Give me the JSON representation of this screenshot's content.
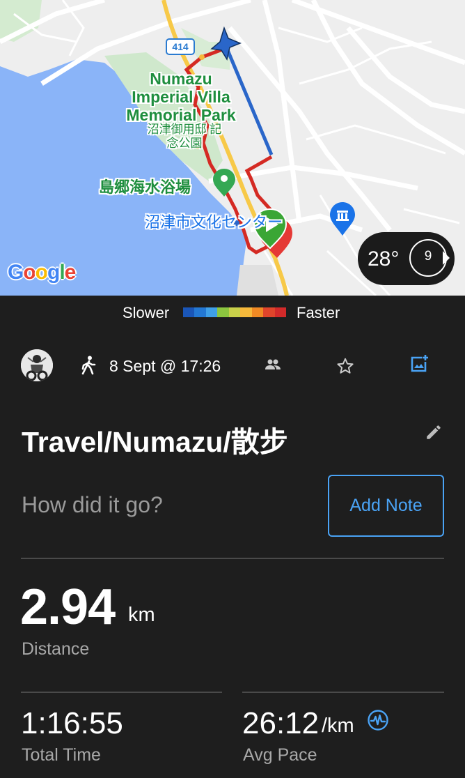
{
  "map": {
    "park_label_en": "Numazu Imperial Villa Memorial Park",
    "park_label_ja": "沼津御用邸 記念公園",
    "beach_label": "島郷海水浴場",
    "culture_label": "沼津市文化センター",
    "road_number": "414",
    "google_logo_letters": [
      "G",
      "o",
      "o",
      "g",
      "l",
      "e"
    ],
    "google_logo_colors": [
      "#4285f4",
      "#ea4335",
      "#fbbc05",
      "#4285f4",
      "#34a853",
      "#ea4335"
    ]
  },
  "weather": {
    "temperature": "28°",
    "wind_speed": "9"
  },
  "legend": {
    "slower_label": "Slower",
    "faster_label": "Faster",
    "gradient_colors": [
      "#1a56b8",
      "#2378d4",
      "#3fa0e8",
      "#8cc63f",
      "#c9d14a",
      "#f6b93b",
      "#f08a24",
      "#e0452b",
      "#d22a2a"
    ]
  },
  "activity": {
    "activity_type_icon": "walking-icon",
    "date": "8 Sept @ 17:26",
    "title": "Travel/Numazu/散步",
    "note_prompt": "How did it go?",
    "add_note_label": "Add Note"
  },
  "stats": {
    "distance_value": "2.94",
    "distance_unit": "km",
    "distance_label": "Distance",
    "total_time_value": "1:16:55",
    "total_time_label": "Total Time",
    "avg_pace_value": "26:12",
    "avg_pace_unit": "/km",
    "avg_pace_label": "Avg Pace"
  },
  "colors": {
    "background": "#1e1e1e",
    "accent": "#4aa3f5",
    "secondary_text": "#a8a8a8",
    "start_marker": "#3aa635",
    "end_marker": "#e53935"
  }
}
